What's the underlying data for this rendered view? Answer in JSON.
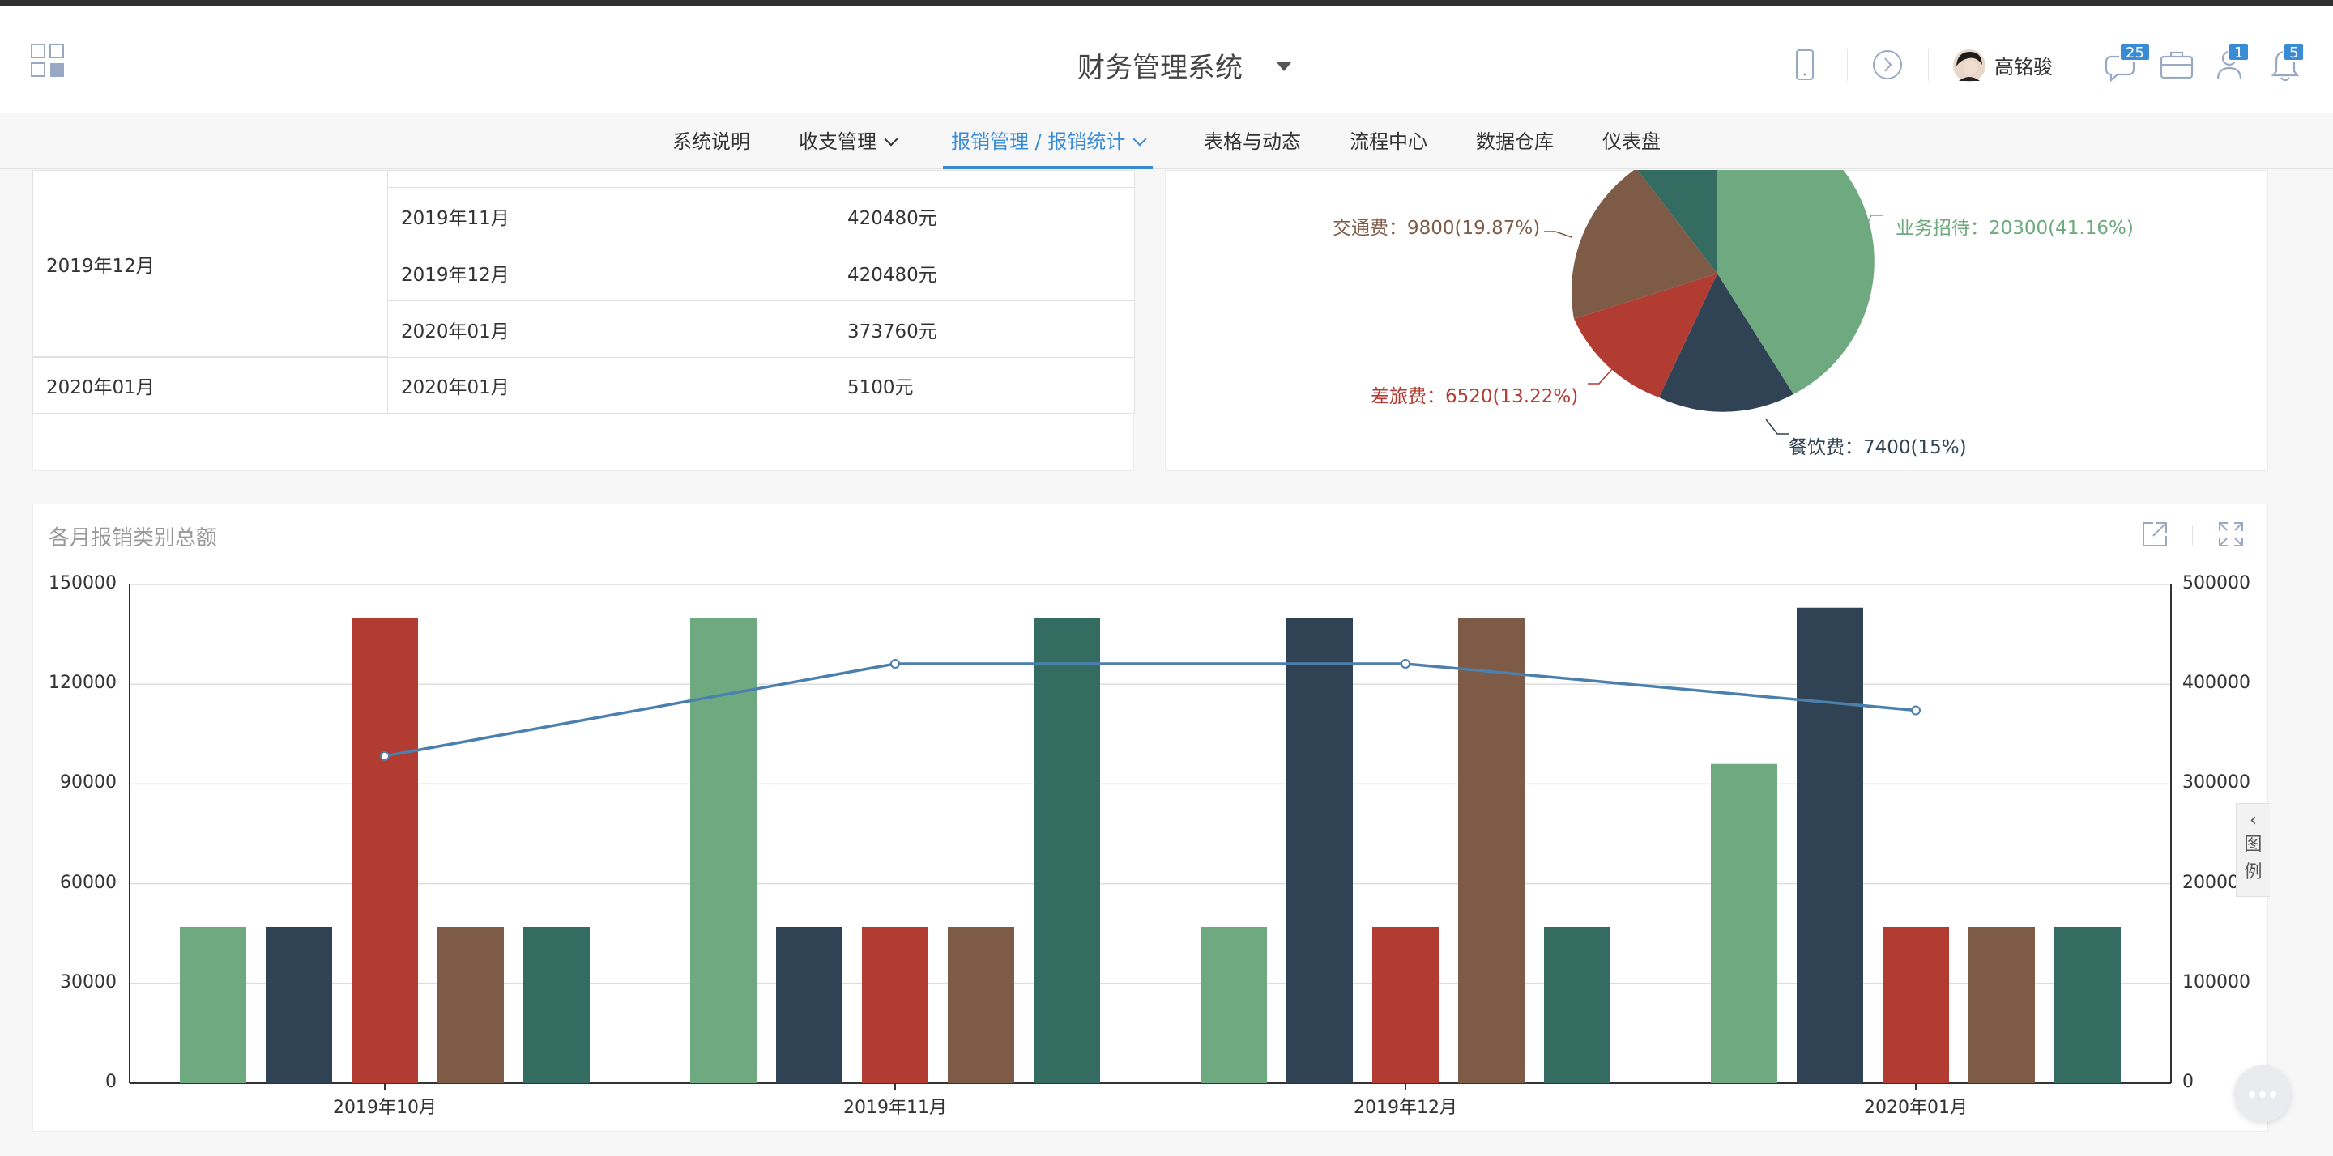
{
  "header": {
    "app_title": "财务管理系统",
    "user_name": "高铭骏",
    "badges": {
      "messages": "25",
      "contacts": "1",
      "notifications": "5"
    }
  },
  "nav": {
    "items": [
      {
        "label": "系统说明"
      },
      {
        "label": "收支管理"
      },
      {
        "label": "报销管理 / 报销统计"
      },
      {
        "label": "表格与动态"
      },
      {
        "label": "流程中心"
      },
      {
        "label": "数据仓库"
      },
      {
        "label": "仪表盘"
      }
    ],
    "active_color": "#3a8bd6"
  },
  "table": {
    "rows": [
      {
        "group": "2019年12月",
        "month": "2019年11月",
        "amount": "420480元"
      },
      {
        "group": "",
        "month": "2019年12月",
        "amount": "420480元"
      },
      {
        "group": "",
        "month": "2020年01月",
        "amount": "373760元"
      },
      {
        "group": "2020年01月",
        "month": "2020年01月",
        "amount": "5100元"
      }
    ]
  },
  "pie": {
    "labels": {
      "jiaotong": "交通费：9800(19.87%)",
      "yewu": "业务招待：20300(41.16%)",
      "chailv": "差旅费：6520(13.22%)",
      "canyin": "餐饮费：7400(15%)"
    },
    "colors": {
      "yewu": "#6fa97f",
      "canyin": "#304354",
      "chailv": "#b23b32",
      "jiaotong": "#7e5b47",
      "other": "#356c61"
    }
  },
  "chart_data": {
    "type": "bar",
    "title": "各月报销类别总额",
    "categories": [
      "2019年10月",
      "2019年11月",
      "2019年12月",
      "2020年01月"
    ],
    "yleft_ticks": [
      "150000",
      "120000",
      "90000",
      "60000",
      "30000",
      "0"
    ],
    "yright_ticks": [
      "500000",
      "400000",
      "300000",
      "200000",
      "100000",
      "0"
    ],
    "ylim_left": [
      0,
      150000
    ],
    "ylim_right": [
      0,
      500000
    ],
    "bar_colors": [
      "#6fa97f",
      "#304354",
      "#b23b32",
      "#7e5b47",
      "#356c61"
    ],
    "line_color": "#4a7fae",
    "series": [
      {
        "values": [
          47000,
          140000,
          47000,
          96000
        ]
      },
      {
        "values": [
          47000,
          47000,
          140000,
          143000
        ]
      },
      {
        "values": [
          140000,
          47000,
          47000,
          47000
        ]
      },
      {
        "values": [
          47000,
          47000,
          140000,
          47000
        ]
      },
      {
        "values": [
          47000,
          140000,
          47000,
          47000
        ]
      }
    ],
    "line": {
      "values": [
        328000,
        420480,
        420480,
        373760
      ]
    }
  },
  "legend_tab": {
    "text": "图例"
  }
}
